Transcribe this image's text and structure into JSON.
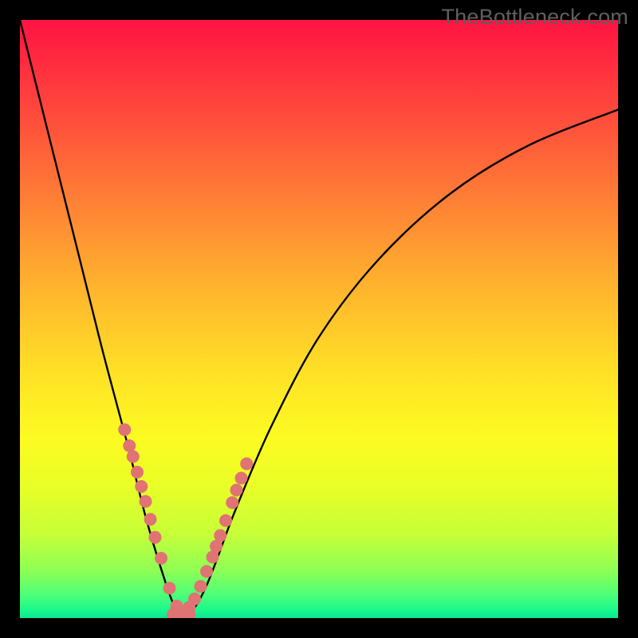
{
  "watermark_text": "TheBottleneck.com",
  "colors": {
    "dot": "#e07373",
    "curve": "#000000",
    "frame_bg": "#000000"
  },
  "chart_data": {
    "type": "line",
    "title": "",
    "xlabel": "",
    "ylabel": "",
    "xlim": [
      0,
      100
    ],
    "ylim": [
      0,
      100
    ],
    "description": "V-shaped bottleneck curve over vertical rainbow gradient (red top → green bottom), minimum near x≈27.",
    "series": [
      {
        "name": "bottleneck-curve",
        "x": [
          0,
          5,
          10,
          14,
          18,
          21,
          24,
          26,
          27,
          29,
          31,
          33,
          36,
          42,
          50,
          60,
          72,
          85,
          100
        ],
        "values": [
          100,
          80,
          60,
          44,
          29,
          17,
          7,
          1.5,
          0.5,
          1.5,
          5,
          10,
          18,
          32,
          47,
          60,
          71,
          79,
          85
        ]
      }
    ],
    "dots_left": {
      "name": "left-cluster",
      "x": [
        17.5,
        18.3,
        18.9,
        19.6,
        20.3,
        21.0,
        21.8,
        22.6,
        23.6,
        25.0,
        26.2
      ],
      "values": [
        31.5,
        28.8,
        27.0,
        24.4,
        22.0,
        19.5,
        16.5,
        13.5,
        10.0,
        5.0,
        2.0
      ]
    },
    "dots_right": {
      "name": "right-cluster",
      "x": [
        28.3,
        29.2,
        30.2,
        31.2,
        32.2,
        32.8,
        33.5,
        34.4,
        35.5,
        36.2,
        37.0,
        37.9
      ],
      "values": [
        1.8,
        3.2,
        5.3,
        7.8,
        10.2,
        12.0,
        13.8,
        16.3,
        19.3,
        21.4,
        23.4,
        25.8
      ]
    },
    "dots_bottom": {
      "name": "bottom-cluster",
      "x": [
        25.6,
        26.5,
        27.4,
        28.3
      ],
      "values": [
        0.6,
        0.5,
        0.5,
        0.6
      ]
    }
  }
}
